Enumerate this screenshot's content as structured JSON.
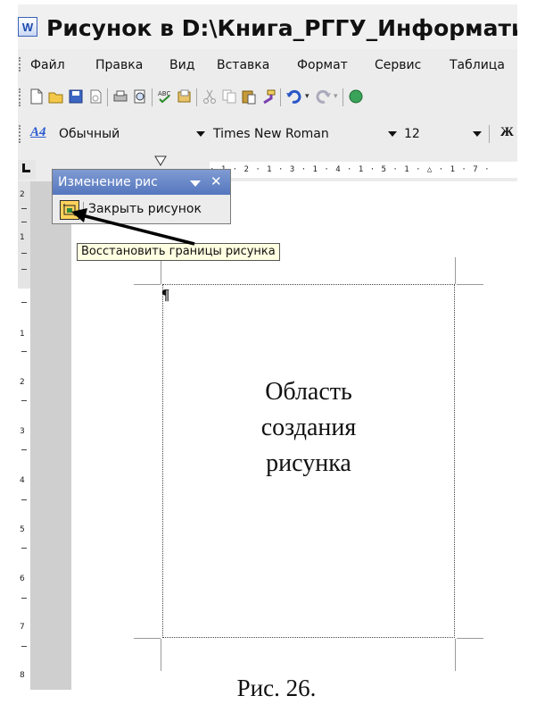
{
  "window": {
    "title": "Рисунок в D:\\Книга_РГГУ_Информатика",
    "app_icon": "word-document-icon"
  },
  "menu": {
    "items": [
      "Файл",
      "Правка",
      "Вид",
      "Вставка",
      "Формат",
      "Сервис",
      "Таблица"
    ]
  },
  "standard_toolbar": {
    "icons": [
      "new-document-icon",
      "open-folder-icon",
      "save-icon",
      "permission-icon",
      "print-icon",
      "print-preview-icon",
      "spelling-icon",
      "research-icon",
      "cut-icon",
      "copy-icon",
      "paste-icon",
      "format-painter-icon",
      "undo-icon",
      "redo-icon",
      "hyperlink-icon"
    ]
  },
  "format_toolbar": {
    "style": "Обычный",
    "font": "Times New Roman",
    "size": "12",
    "bold_label": "Ж"
  },
  "ruler": {
    "horizontal_ticks": "· 1 · 2 · 1 · 3 · 1 · 4 · 1 · 5 · 1 · △ · 1 · 7 ·",
    "vertical_labels": [
      "2",
      "1",
      "1",
      "2",
      "3",
      "4",
      "5",
      "6",
      "7",
      "8"
    ]
  },
  "drawing_toolbar": {
    "title": "Изменение рис",
    "close_picture_label": "Закрыть рисунок",
    "reset_button_icon": "picture-bounds-icon",
    "tooltip": "Восстановить границы рисунка"
  },
  "document": {
    "paragraph_mark": "¶",
    "canvas_lines": [
      "Область",
      "создания",
      "рисунка"
    ]
  },
  "caption": "Рис. 26."
}
